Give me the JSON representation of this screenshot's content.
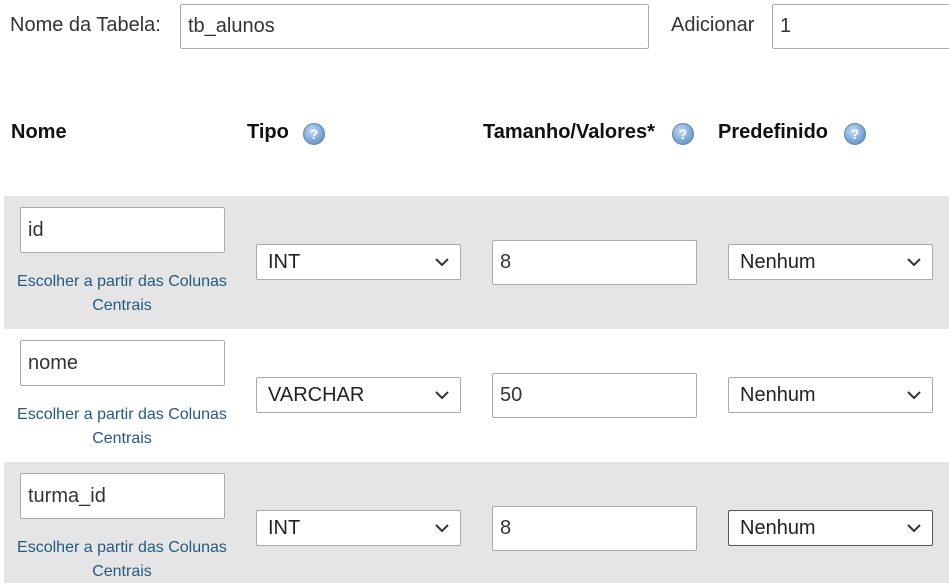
{
  "top": {
    "table_name_label": "Nome da Tabela:",
    "table_name_value": "tb_alunos",
    "add_label": "Adicionar",
    "add_value": "1"
  },
  "headers": {
    "name": "Nome",
    "type": "Tipo",
    "length": "Tamanho/Valores*",
    "default": "Predefinido"
  },
  "help_icon_glyph": "?",
  "rows": [
    {
      "name": "id",
      "link_line1": "Escolher a partir das Colunas",
      "link_line2": "Centrais",
      "type": "INT",
      "length": "8",
      "default": "Nenhum"
    },
    {
      "name": "nome",
      "link_line1": "Escolher a partir das Colunas",
      "link_line2": "Centrais",
      "type": "VARCHAR",
      "length": "50",
      "default": "Nenhum"
    },
    {
      "name": "turma_id",
      "link_line1": "Escolher a partir das Colunas",
      "link_line2": "Centrais",
      "type": "INT",
      "length": "8",
      "default": "Nenhum"
    }
  ]
}
